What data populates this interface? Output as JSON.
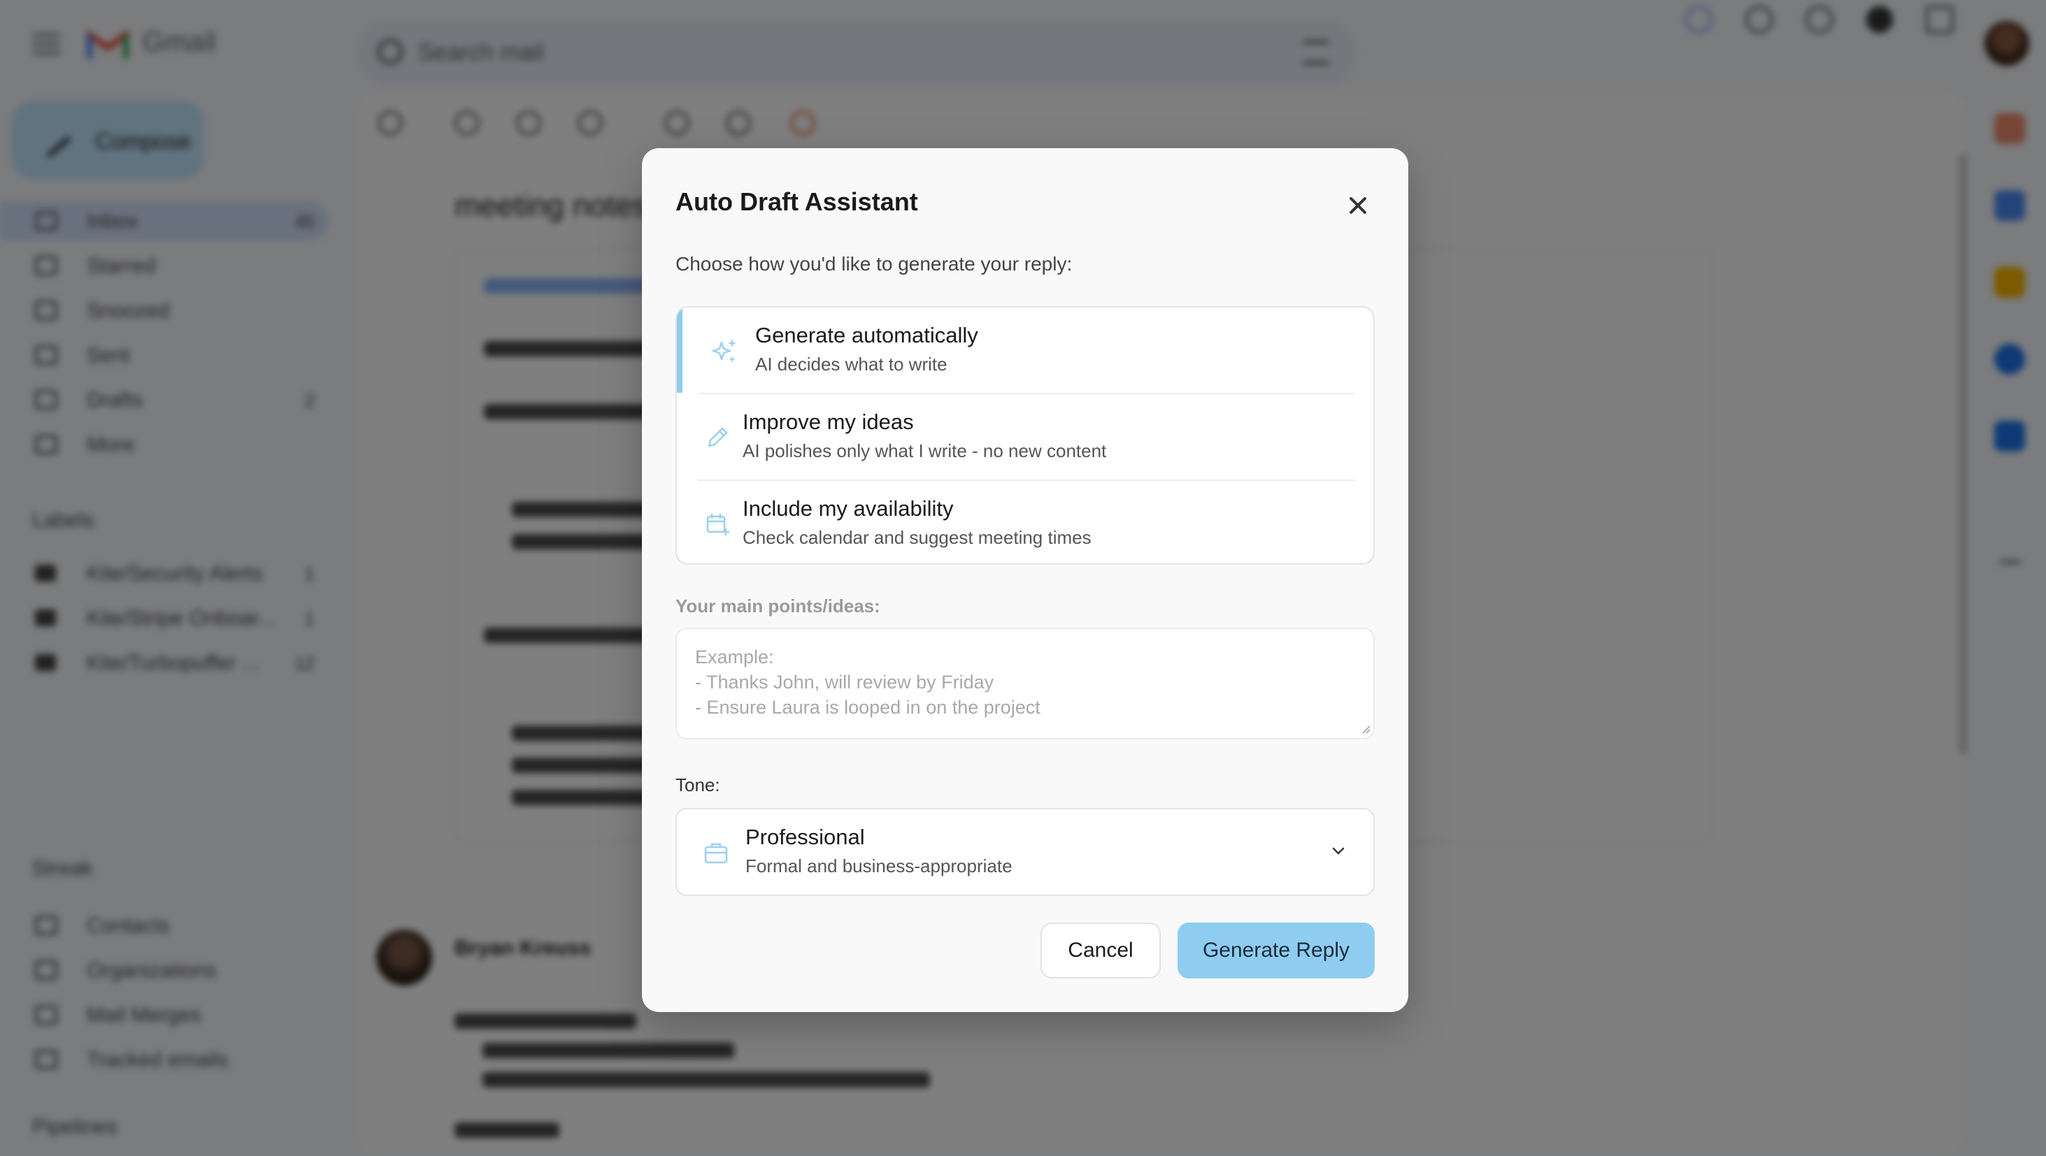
{
  "background": {
    "app_name": "Gmail",
    "search_placeholder": "Search mail",
    "compose_label": "Compose",
    "nav": [
      {
        "label": "Inbox",
        "count": "45"
      },
      {
        "label": "Starred",
        "count": ""
      },
      {
        "label": "Snoozed",
        "count": ""
      },
      {
        "label": "Sent",
        "count": ""
      },
      {
        "label": "Drafts",
        "count": "2"
      },
      {
        "label": "More",
        "count": ""
      }
    ],
    "labels_heading": "Labels",
    "labels": [
      {
        "label": "Kite/Security Alerts",
        "count": "1"
      },
      {
        "label": "Kite/Stripe Onboar...",
        "count": "1"
      },
      {
        "label": "Kite/Turbopuffer ...",
        "count": "12"
      }
    ],
    "streak_heading": "Streak",
    "streak_items": [
      "Contacts",
      "Organizations",
      "Mail Merges",
      "Tracked emails"
    ],
    "pipelines_heading": "Pipelines",
    "email_subject": "meeting notes",
    "sender_name": "Bryan Kreuss"
  },
  "modal": {
    "title": "Auto Draft Assistant",
    "subtitle": "Choose how you'd like to generate your reply:",
    "options": [
      {
        "title": "Generate automatically",
        "desc": "AI decides what to write",
        "icon": "sparkle-icon",
        "selected": true
      },
      {
        "title": "Improve my ideas",
        "desc": "AI polishes only what I write - no new content",
        "icon": "pencil-icon",
        "selected": false
      },
      {
        "title": "Include my availability",
        "desc": "Check calendar and suggest meeting times",
        "icon": "calendar-plus-icon",
        "selected": false
      }
    ],
    "points_label": "Your main points/ideas:",
    "points_placeholder": "Example:\n- Thanks John, will review by Friday\n- Ensure Laura is looped in on the project",
    "tone_label": "Tone:",
    "tone": {
      "title": "Professional",
      "desc": "Formal and business-appropriate",
      "icon": "briefcase-icon"
    },
    "cancel_label": "Cancel",
    "generate_label": "Generate Reply",
    "colors": {
      "accent": "#8ecdf0",
      "icon": "#9bd0ee"
    }
  }
}
